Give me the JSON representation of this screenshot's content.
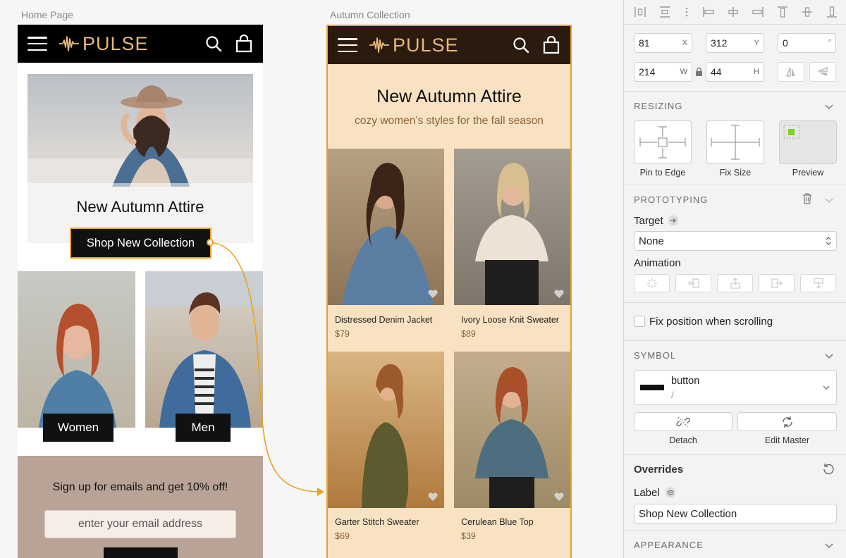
{
  "home": {
    "artboard_label": "Home Page",
    "logo": "PULSE",
    "hero_title": "New Autumn Attire",
    "hero_button": "Shop New Collection",
    "women_label": "Women",
    "men_label": "Men",
    "signup_text": "Sign up for emails and get 10% off!",
    "email_placeholder": "enter your email address"
  },
  "autumn": {
    "artboard_label": "Autumn Collection",
    "logo": "PULSE",
    "title": "New Autumn Attire",
    "subtitle": "cozy women’s styles for the fall season",
    "products": [
      {
        "name": "Distressed Denim Jacket",
        "price": "$79"
      },
      {
        "name": "Ivory Loose Knit Sweater",
        "price": "$89"
      },
      {
        "name": "Garter Stitch Sweater",
        "price": "$69"
      },
      {
        "name": "Cerulean Blue Top",
        "price": "$39"
      }
    ]
  },
  "inspector": {
    "x": {
      "value": "81",
      "suffix": "X"
    },
    "y": {
      "value": "312",
      "suffix": "Y"
    },
    "rotation": {
      "value": "0",
      "suffix": "°"
    },
    "w": {
      "value": "214",
      "suffix": "W"
    },
    "h": {
      "value": "44",
      "suffix": "H"
    },
    "resizing": {
      "title": "RESIZING",
      "pin": "Pin to Edge",
      "fix": "Fix Size",
      "preview": "Preview"
    },
    "prototyping": {
      "title": "PROTOTYPING",
      "target_label": "Target",
      "target_value": "None",
      "animation_label": "Animation",
      "fix_position": "Fix position when scrolling"
    },
    "symbol": {
      "title": "SYMBOL",
      "name": "button",
      "path": "/",
      "detach": "Detach",
      "edit_master": "Edit Master"
    },
    "overrides": {
      "title": "Overrides",
      "label_title": "Label",
      "label_value": "Shop New Collection"
    },
    "appearance": {
      "title": "APPEARANCE"
    }
  },
  "colors": {
    "accent": "#e9a323",
    "autumn_bg": "#f8e2c2",
    "autumn_nav": "#2b1a0e",
    "logo_gold": "#e8b97c",
    "signup_bg": "#b9a396"
  }
}
